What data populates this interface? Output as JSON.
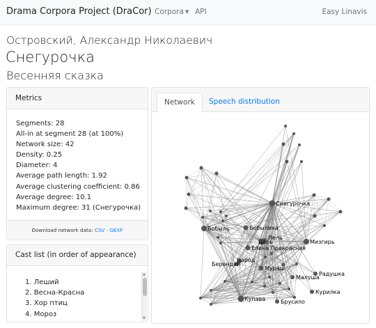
{
  "navbar": {
    "brand": "Drama Corpora Project (DraCor)",
    "corpora": "Corpora",
    "api": "API",
    "right": "Easy Linavis"
  },
  "play": {
    "author": "Островский, Александр Николаевич",
    "title": "Снегурочка",
    "subtitle": "Весенняя сказка"
  },
  "metrics": {
    "header": "Metrics",
    "items": [
      "Segments: 28",
      "All-in at segment 28 (at 100%)",
      "Network size: 42",
      "Density: 0.25",
      "Diameter: 4",
      "Average path length: 1.92",
      "Average clustering coefficient: 0.86",
      "Average degree: 10.1",
      "Maximum degree: 31 (Снегурочка)"
    ],
    "download_label": "Download network data:",
    "csv": "CSV",
    "sep": "·",
    "gexf": "GEXF"
  },
  "cast": {
    "header": "Cast list (in order of appearance)",
    "items": [
      "1. Леший",
      "2. Весна-Красна",
      "3. Хор птиц",
      "4. Мороз"
    ]
  },
  "tabs": {
    "network": "Network",
    "speech": "Speech distribution"
  },
  "network": {
    "labels": [
      "Снегурочка",
      "Бобыль",
      "Бобылиха",
      "Лель",
      "Царь",
      "Мизгирь",
      "Елена Прекрасная",
      "Берендей",
      "Народ",
      "Мураш",
      "Радушка",
      "Малуша",
      "Купава",
      "Брусило",
      "Курилка"
    ]
  }
}
